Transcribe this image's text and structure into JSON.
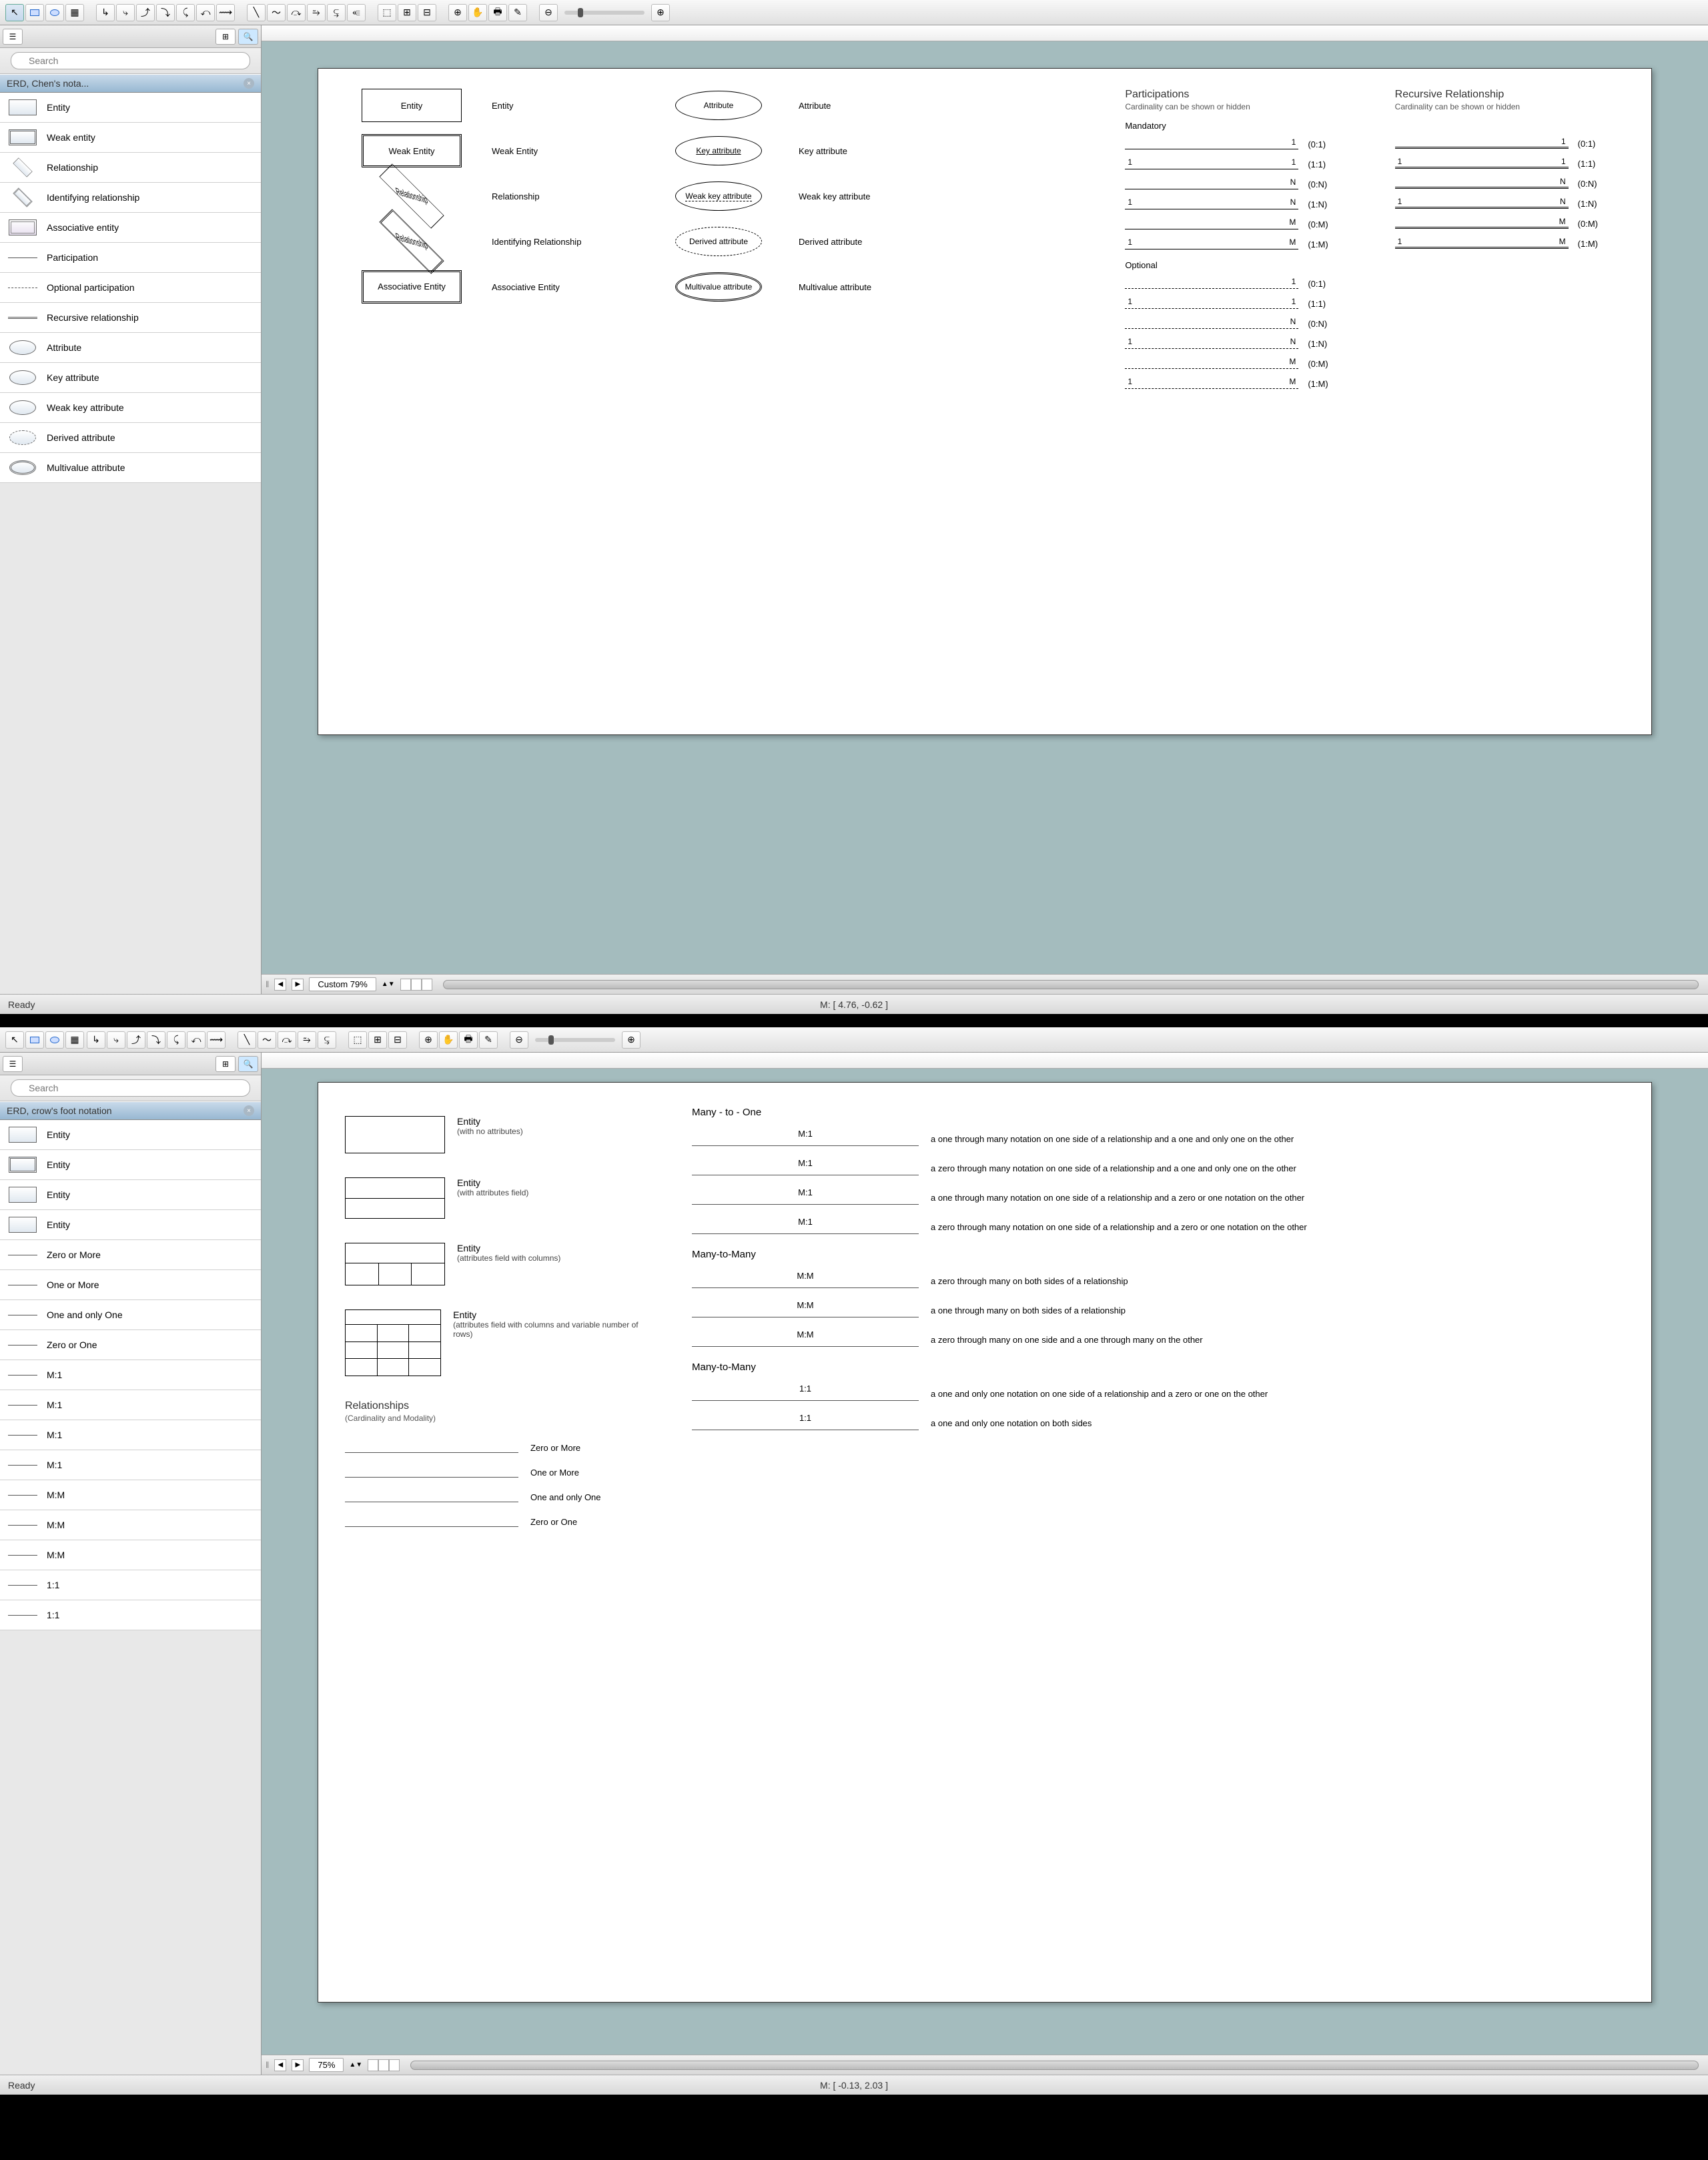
{
  "window1": {
    "sidebar": {
      "search_placeholder": "Search",
      "palette_title": "ERD, Chen's nota...",
      "items": [
        "Entity",
        "Weak entity",
        "Relationship",
        "Identifying relationship",
        "Associative entity",
        "Participation",
        "Optional participation",
        "Recursive relationship",
        "Attribute",
        "Key attribute",
        "Weak key attribute",
        "Derived attribute",
        "Multivalue attribute"
      ]
    },
    "canvas": {
      "shapes": {
        "entity": {
          "shape_label": "Entity",
          "name": "Entity"
        },
        "weak_entity": {
          "shape_label": "Weak Entity",
          "name": "Weak Entity"
        },
        "relationship": {
          "shape_label": "Relationship",
          "name": "Relationship"
        },
        "identifying": {
          "shape_label": "Relationship",
          "name": "Identifying Relationship"
        },
        "associative": {
          "shape_label": "Associative Entity",
          "name": "Associative Entity"
        },
        "attribute": {
          "shape_label": "Attribute",
          "name": "Attribute"
        },
        "key_attr": {
          "shape_label": "Key attribute",
          "name": "Key attribute"
        },
        "weak_key": {
          "shape_label": "Weak key attribute",
          "name": "Weak key attribute"
        },
        "derived": {
          "shape_label": "Derived attribute",
          "name": "Derived attribute"
        },
        "multivalue": {
          "shape_label": "Multivalue attribute",
          "name": "Multivalue attribute"
        }
      },
      "participations": {
        "title": "Participations",
        "subtitle": "Cardinality can be shown or hidden",
        "mandatory_title": "Mandatory",
        "optional_title": "Optional",
        "mandatory": [
          {
            "left": "",
            "right": "1",
            "label": "(0:1)"
          },
          {
            "left": "1",
            "right": "1",
            "label": "(1:1)"
          },
          {
            "left": "",
            "right": "N",
            "label": "(0:N)"
          },
          {
            "left": "1",
            "right": "N",
            "label": "(1:N)"
          },
          {
            "left": "",
            "right": "M",
            "label": "(0:M)"
          },
          {
            "left": "1",
            "right": "M",
            "label": "(1:M)"
          }
        ],
        "optional": [
          {
            "left": "",
            "right": "1",
            "label": "(0:1)"
          },
          {
            "left": "1",
            "right": "1",
            "label": "(1:1)"
          },
          {
            "left": "",
            "right": "N",
            "label": "(0:N)"
          },
          {
            "left": "1",
            "right": "N",
            "label": "(1:N)"
          },
          {
            "left": "",
            "right": "M",
            "label": "(0:M)"
          },
          {
            "left": "1",
            "right": "M",
            "label": "(1:M)"
          }
        ]
      },
      "recursive": {
        "title": "Recursive Relationship",
        "subtitle": "Cardinality can be shown or hidden",
        "items": [
          {
            "left": "",
            "right": "1",
            "label": "(0:1)"
          },
          {
            "left": "1",
            "right": "1",
            "label": "(1:1)"
          },
          {
            "left": "",
            "right": "N",
            "label": "(0:N)"
          },
          {
            "left": "1",
            "right": "N",
            "label": "(1:N)"
          },
          {
            "left": "",
            "right": "M",
            "label": "(0:M)"
          },
          {
            "left": "1",
            "right": "M",
            "label": "(1:M)"
          }
        ]
      }
    },
    "zoom": "Custom 79%",
    "mouse": "M: [ 4.76, -0.62 ]",
    "status": "Ready"
  },
  "window2": {
    "sidebar": {
      "search_placeholder": "Search",
      "palette_title": "ERD, crow's foot notation",
      "items": [
        "Entity",
        "Entity",
        "Entity",
        "Entity",
        "Zero or More",
        "One or More",
        "One and only One",
        "Zero or One",
        "M:1",
        "M:1",
        "M:1",
        "M:1",
        "M:M",
        "M:M",
        "M:M",
        "1:1",
        "1:1"
      ]
    },
    "canvas": {
      "entities": [
        {
          "title": "Entity",
          "sub": "(with no attributes)"
        },
        {
          "title": "Entity",
          "sub": "(with attributes field)"
        },
        {
          "title": "Entity",
          "sub": "(attributes field with columns)"
        },
        {
          "title": "Entity",
          "sub": "(attributes field with columns and variable number of rows)"
        }
      ],
      "relationships_title": "Relationships",
      "relationships_sub": "(Cardinality and Modality)",
      "cardinality": [
        {
          "name": "Zero or More"
        },
        {
          "name": "One or More"
        },
        {
          "name": "One and only One"
        },
        {
          "name": "Zero or One"
        }
      ],
      "many_to_one": {
        "title": "Many - to - One",
        "items": [
          {
            "label": "M:1",
            "desc": "a one through many notation on one side of a relationship and a one and only one on the other"
          },
          {
            "label": "M:1",
            "desc": "a zero through many notation on one side of a relationship and a one and only one on the other"
          },
          {
            "label": "M:1",
            "desc": "a one through many notation on one side of a relationship and a zero or one notation on the other"
          },
          {
            "label": "M:1",
            "desc": "a zero through many notation on one side of a relationship and a zero or one notation on the other"
          }
        ]
      },
      "many_to_many": {
        "title": "Many-to-Many",
        "items": [
          {
            "label": "M:M",
            "desc": "a zero through many on both sides of a relationship"
          },
          {
            "label": "M:M",
            "desc": "a one through many on both sides of a relationship"
          },
          {
            "label": "M:M",
            "desc": "a zero through many on one side and a one through many on the other"
          }
        ]
      },
      "one_to_one": {
        "title": "Many-to-Many",
        "items": [
          {
            "label": "1:1",
            "desc": "a one and only one notation on one side of a relationship and a zero or one on the other"
          },
          {
            "label": "1:1",
            "desc": "a one and only one notation on both sides"
          }
        ]
      }
    },
    "zoom": "75%",
    "mouse": "M: [ -0.13, 2.03 ]",
    "status": "Ready"
  }
}
